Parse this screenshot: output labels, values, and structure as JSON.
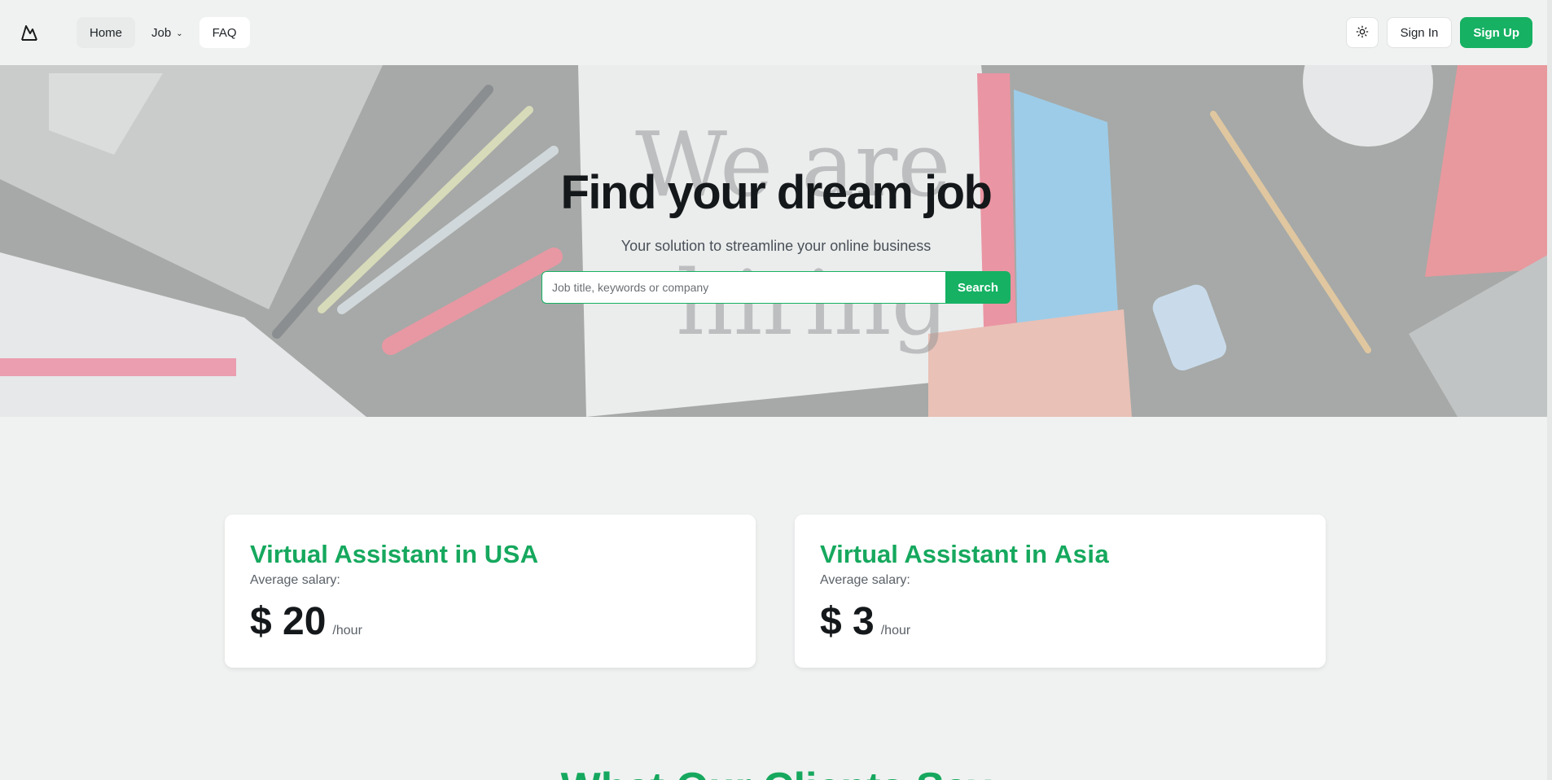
{
  "nav": {
    "logo_icon": "mountain-logo-icon",
    "home": "Home",
    "job": "Job",
    "faq": "FAQ",
    "sign_in": "Sign In",
    "sign_up": "Sign Up",
    "theme_icon": "sun-icon"
  },
  "hero": {
    "title": "Find your dream job",
    "subtitle": "Your solution to streamline your online business",
    "search_placeholder": "Job title, keywords or company",
    "search_button": "Search",
    "background_image": "megaphone-we-are-hiring-photo"
  },
  "cards": [
    {
      "title_prefix": "Virtual Assistant in ",
      "region": "USA",
      "label": "Average salary:",
      "value": "$ 20",
      "unit": "/hour"
    },
    {
      "title_prefix": "Virtual Assistant in ",
      "region": "Asia",
      "label": "Average salary:",
      "value": "$ 3",
      "unit": "/hour"
    }
  ],
  "section": {
    "heading": "What Our Clients Say"
  },
  "colors": {
    "accent": "#16b163",
    "heading_green": "#16a85e",
    "page_bg": "#f0f2f1"
  }
}
